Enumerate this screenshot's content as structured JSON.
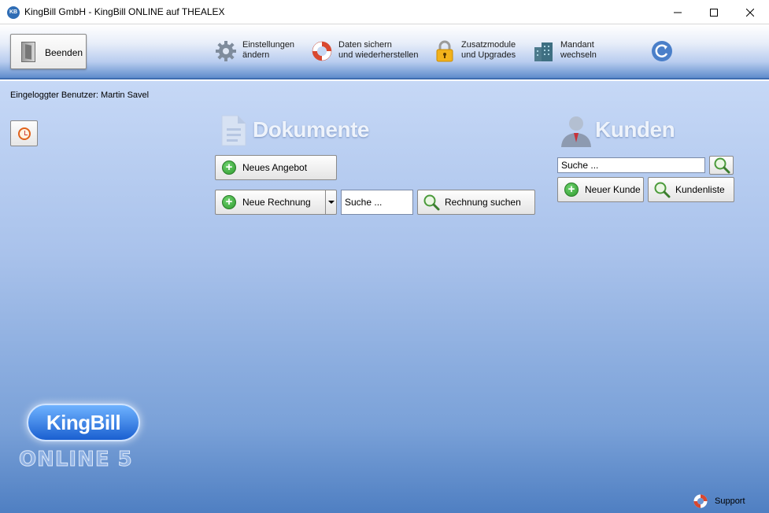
{
  "window": {
    "app_icon_text": "KB",
    "title": "KingBill GmbH - KingBill ONLINE auf THEALEX"
  },
  "toolbar": {
    "beenden_label": "Beenden",
    "settings_line1": "Einstellungen",
    "settings_line2": "ändern",
    "backup_line1": "Daten sichern",
    "backup_line2": "und wiederherstellen",
    "addons_line1": "Zusatzmodule",
    "addons_line2": "und Upgrades",
    "mandant_line1": "Mandant",
    "mandant_line2": "wechseln"
  },
  "user": {
    "logged_in": "Eingeloggter Benutzer: Martin Savel"
  },
  "dokumente": {
    "title": "Dokumente",
    "neues_angebot": "Neues Angebot",
    "neue_rechnung": "Neue Rechnung",
    "search_placeholder": "Suche ...",
    "rechnung_suchen": "Rechnung suchen"
  },
  "kunden": {
    "title": "Kunden",
    "search_placeholder": "Suche ...",
    "neuer_kunde": "Neuer Kunde",
    "kundenliste": "Kundenliste"
  },
  "logo": {
    "brand": "KingBill",
    "edition": "ONLINE 5"
  },
  "footer": {
    "support_label": "Support"
  },
  "colors": {
    "accent_blue": "#3f6db0",
    "plus_green": "#2e9a2e"
  }
}
